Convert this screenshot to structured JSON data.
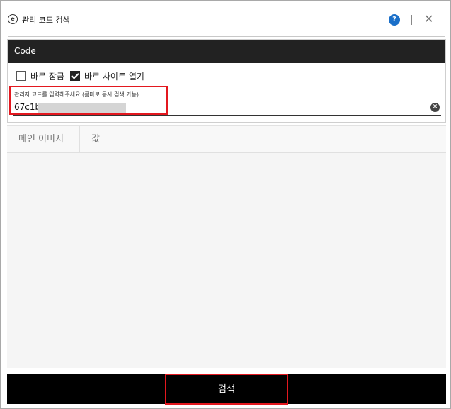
{
  "window": {
    "title": "관리 코드 검색",
    "app_icon_glyph": "e",
    "help_glyph": "?",
    "close_glyph": "✕"
  },
  "panel": {
    "header": "Code",
    "checkboxes": [
      {
        "label": "바로 잠금",
        "checked": false
      },
      {
        "label": "바로 사이트 열기",
        "checked": true
      }
    ],
    "code_field": {
      "label": "관리자 코드를 입력해주세요.(콤마로 동시 검색 가능)",
      "value": "67c1b",
      "clear_glyph": "✕"
    }
  },
  "table": {
    "columns": [
      "메인 이미지",
      "값"
    ]
  },
  "search_button": {
    "label": "검색"
  },
  "colors": {
    "header_bg": "#222222",
    "highlight": "#e3181f",
    "help_blue": "#1a6fc9",
    "button_bg": "#000000"
  }
}
